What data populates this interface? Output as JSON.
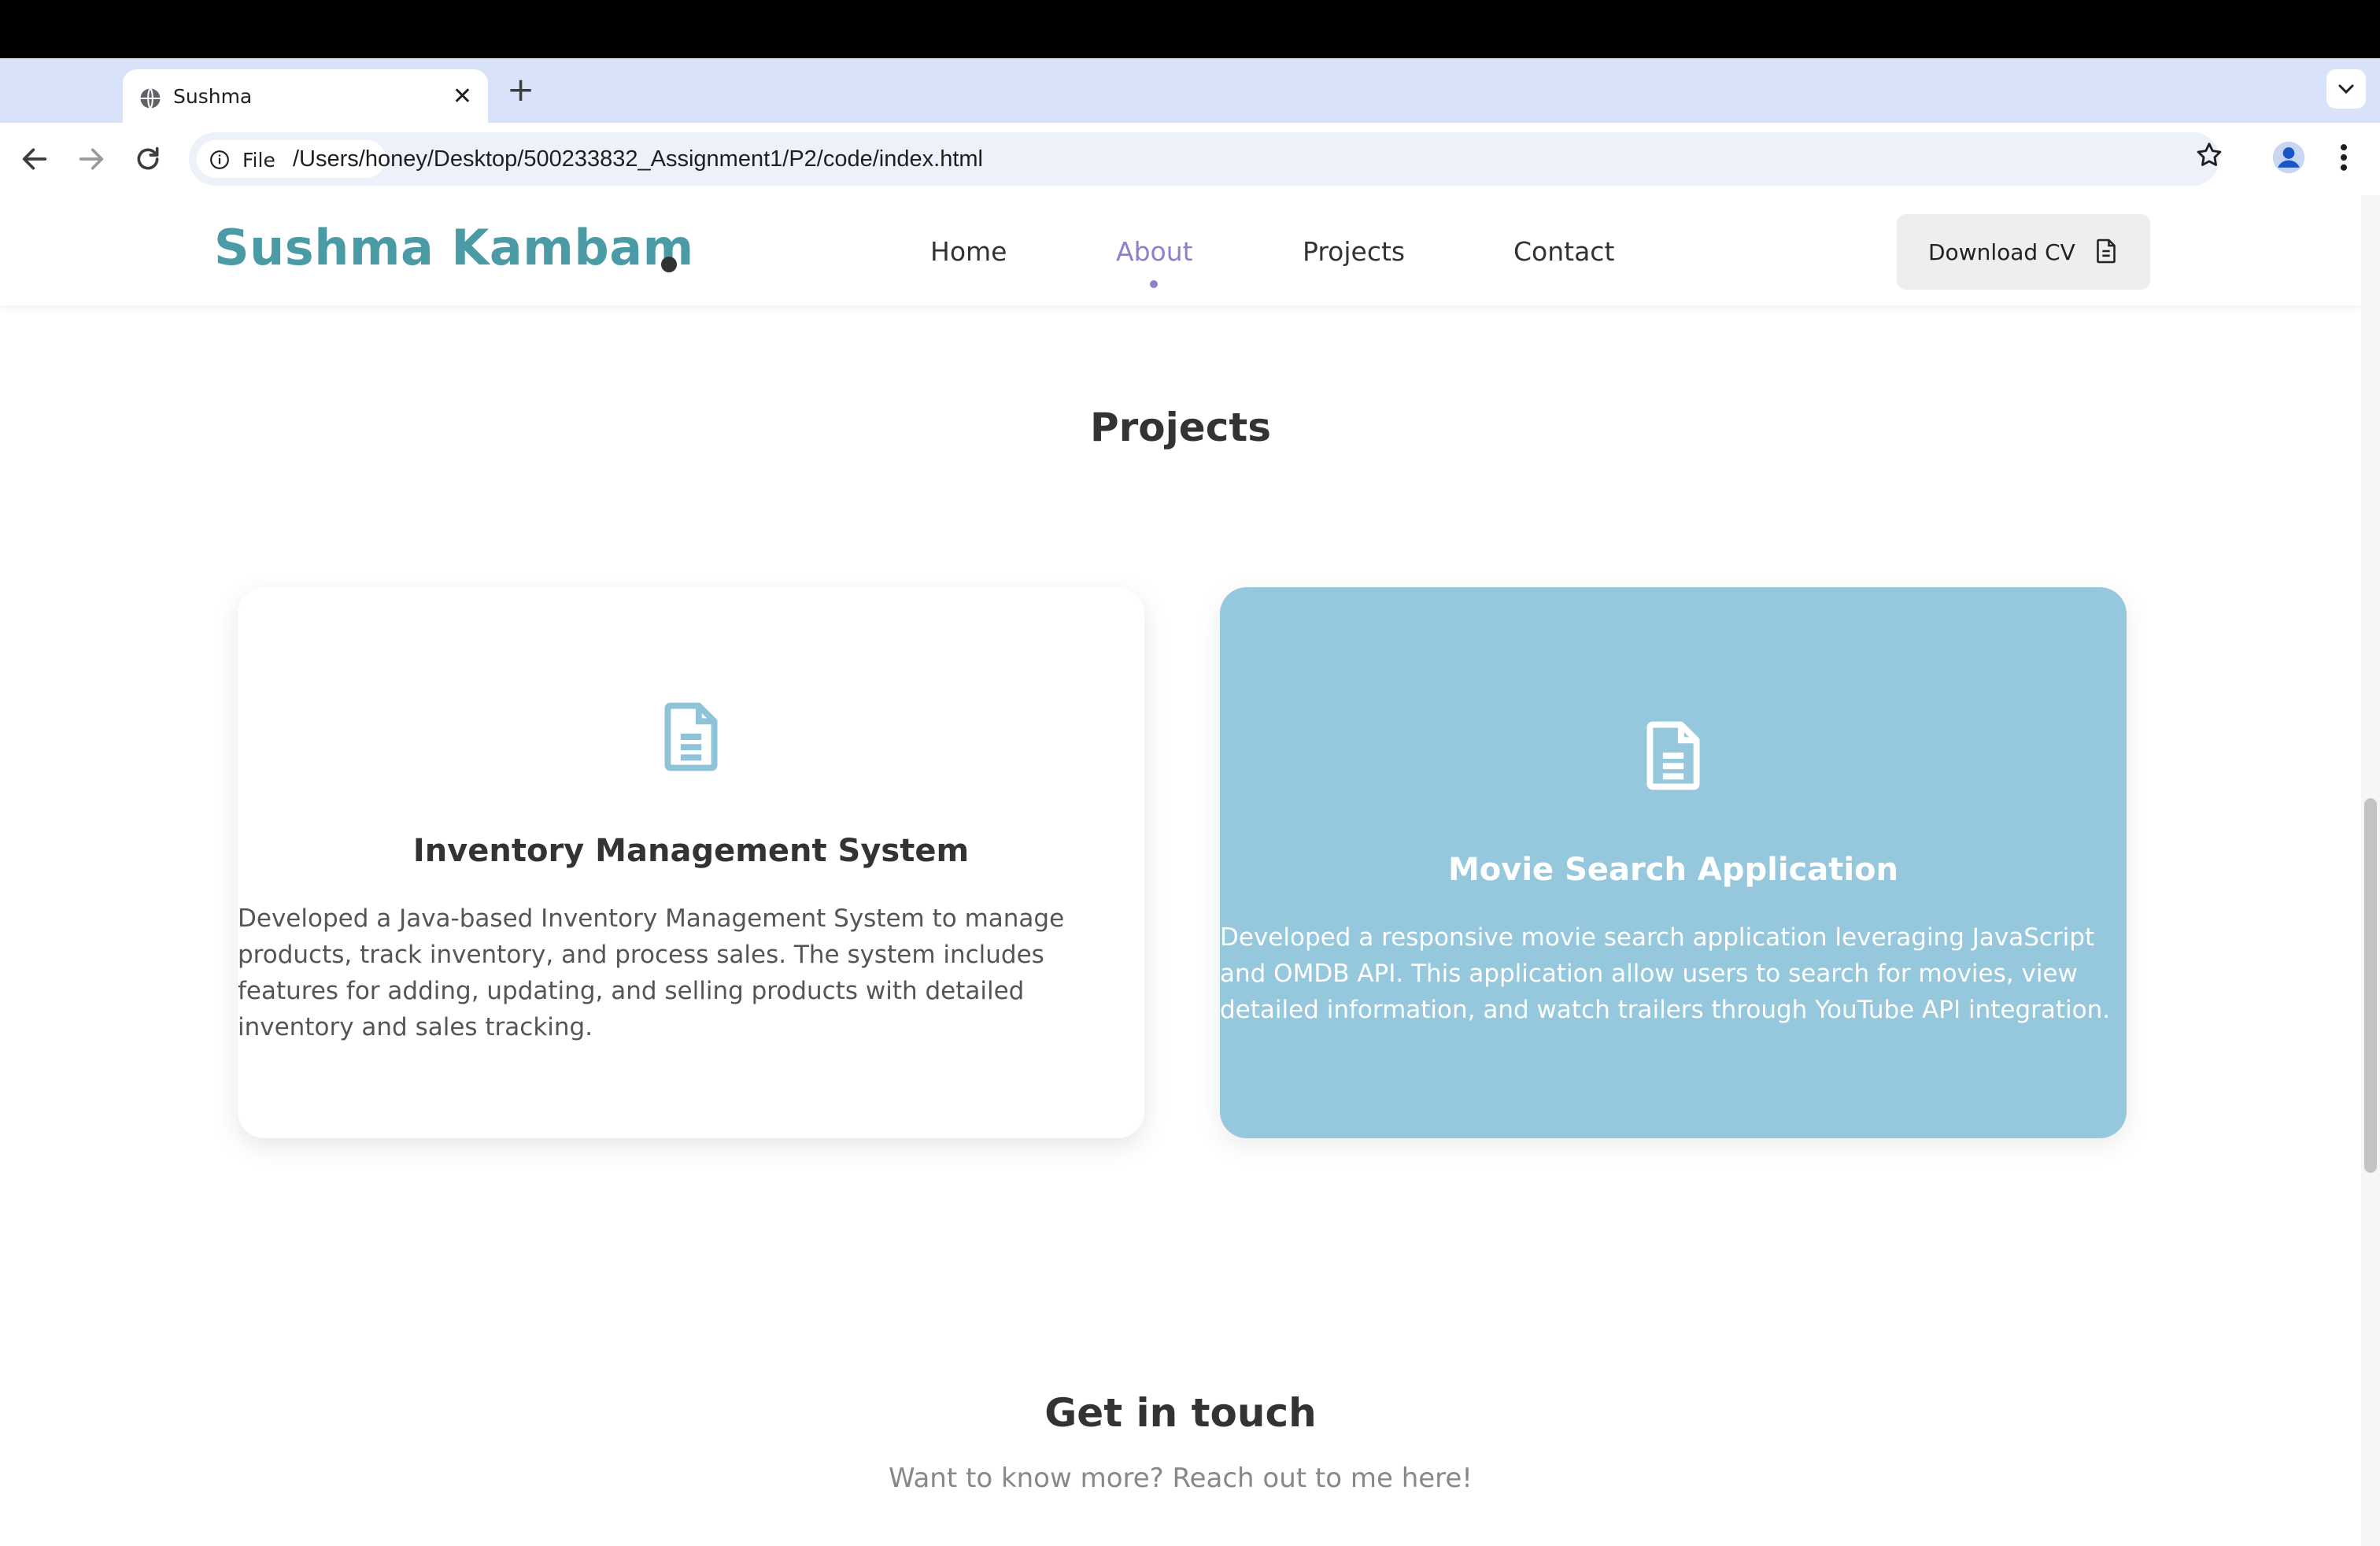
{
  "browser": {
    "tab_title": "Sushma",
    "tab_close": "✕",
    "new_tab": "+",
    "file_chip_label": "File",
    "url": "/Users/honey/Desktop/500233832_Assignment1/P2/code/index.html"
  },
  "site": {
    "logo": "Sushma Kambam",
    "nav": [
      {
        "label": "Home",
        "active": false
      },
      {
        "label": "About",
        "active": true
      },
      {
        "label": "Projects",
        "active": false
      },
      {
        "label": "Contact",
        "active": false
      }
    ],
    "download_cv": "Download CV"
  },
  "projects": {
    "heading": "Projects",
    "cards": [
      {
        "title": "Inventory Management System",
        "description": "Developed a Java-based Inventory Management System to manage products, track inventory, and process sales. The system includes features for adding, updating, and selling products with detailed inventory and sales tracking.",
        "style": "light"
      },
      {
        "title": "Movie Search Application",
        "description": "Developed a responsive movie search application leveraging JavaScript and OMDB API. This application allow users to search for movies, view detailed information, and watch trailers through YouTube API integration.",
        "style": "accent"
      }
    ]
  },
  "contact": {
    "heading": "Get in touch",
    "subtitle": "Want to know more? Reach out to me here!"
  },
  "colors": {
    "brand": "#4a9ba6",
    "active_nav": "#8c82c9",
    "card_accent": "#95c8dc",
    "icon_blue": "#8fc3d8"
  },
  "icons": [
    "globe-icon",
    "back-arrow-icon",
    "forward-arrow-icon",
    "reload-icon",
    "info-icon",
    "star-icon",
    "profile-icon",
    "more-vert-icon",
    "document-icon",
    "chevron-down-icon"
  ]
}
